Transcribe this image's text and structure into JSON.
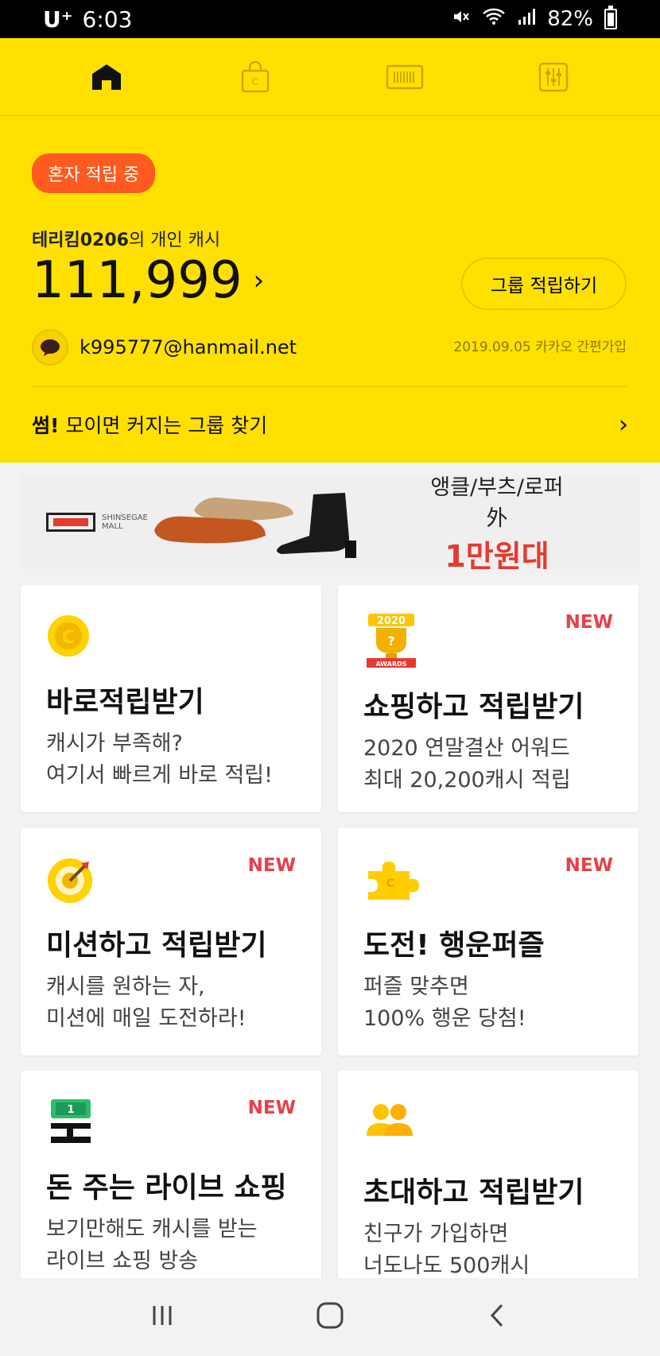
{
  "status_bar": {
    "carrier": "U⁺",
    "time": "6:03",
    "battery": "82%"
  },
  "tabs": [
    {
      "name": "home",
      "icon": "home-icon"
    },
    {
      "name": "shop",
      "icon": "shopping-bag-icon"
    },
    {
      "name": "barcode",
      "icon": "barcode-icon"
    },
    {
      "name": "settings",
      "icon": "sliders-icon"
    }
  ],
  "account": {
    "mode_badge": "혼자 적립 중",
    "owner_name": "테리킴0206",
    "owner_suffix": "의 개인 캐시",
    "balance": "111,999",
    "group_button": "그룹 적립하기",
    "email": "k995777@hanmail.net",
    "joined": "2019.09.05 카카오 간편가입",
    "find_prefix": "썸!",
    "find_text": "모이면 커지는 그룹 찾기"
  },
  "banner": {
    "brand": "SHINSEGAE MALL",
    "line1": "앵클/부츠/로퍼 外",
    "line2": "1만원대"
  },
  "cards": [
    {
      "title": "바로적립받기",
      "desc1": "캐시가 부족해?",
      "desc2": "여기서 빠르게 바로 적립!",
      "new": "",
      "icon": "cash-coin-icon"
    },
    {
      "title": "쇼핑하고 적립받기",
      "desc1": "2020 연말결산 어워드",
      "desc2": "최대 20,200캐시 적립",
      "new": "NEW",
      "icon": "awards-trophy-icon"
    },
    {
      "title": "미션하고 적립받기",
      "desc1": "캐시를 원하는 자,",
      "desc2": "미션에 매일 도전하라!",
      "new": "NEW",
      "icon": "target-icon"
    },
    {
      "title": "도전! 행운퍼즐",
      "desc1": "퍼즐 맞추면",
      "desc2": "100% 행운 당첨!",
      "new": "NEW",
      "icon": "puzzle-icon"
    },
    {
      "title": "돈 주는 라이브 쇼핑",
      "desc1": "보기만해도 캐시를 받는",
      "desc2": "라이브 쇼핑 방송",
      "new": "NEW",
      "icon": "money-live-icon"
    },
    {
      "title": "초대하고 적립받기",
      "desc1": "친구가 가입하면",
      "desc2": "너도나도 500캐시",
      "new": "",
      "icon": "friends-icon"
    }
  ],
  "colors": {
    "yellow": "#ffe000",
    "badge": "#ff5a1f",
    "new": "#e8404a"
  }
}
